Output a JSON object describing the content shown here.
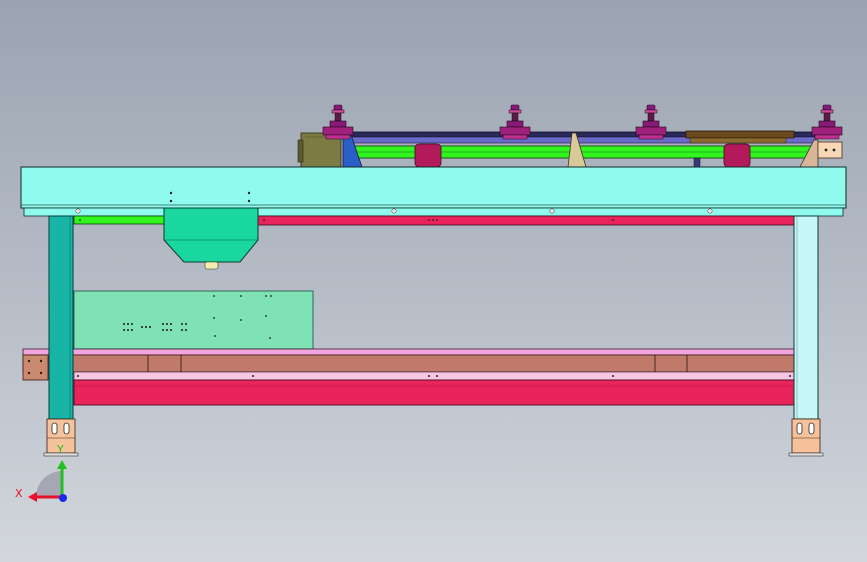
{
  "view": {
    "background_top": "#9aa4b1",
    "background_bottom": "#d3d7dd"
  },
  "colors": {
    "beam_fill": "#8ffbee",
    "leg_fill": "#18b5a6",
    "leg_fill_right": "#c7f6f6",
    "hopper_fill": "#19d79e",
    "panel_fill": "#7ee2b5",
    "green_rail": "#32f51f",
    "red_rail": "#e8245b",
    "crossbar_brown": "#c07a6c",
    "pink_strip": "#f2a6df",
    "motor_olive": "#7c7b44",
    "roller_magenta": "#b21a5c",
    "clamp_purple": "#8a1a7a",
    "foot_peach": "#f6c29c",
    "outline": "#1a1a2a"
  },
  "triad": {
    "x_label": "X",
    "y_label": "Y",
    "x_color": "#e8122a",
    "y_color": "#20c020",
    "z_color": "#1a2ae8"
  },
  "clamps": {
    "count": 4
  }
}
